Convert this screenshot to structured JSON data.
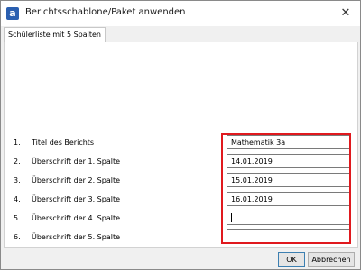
{
  "window": {
    "title": "Berichtsschablone/Paket anwenden",
    "app_icon": "a",
    "close_glyph": "✕"
  },
  "tabs": [
    {
      "label": "Schülerliste mit 5 Spalten",
      "active": true
    }
  ],
  "rows": [
    {
      "num": "1.",
      "label": "Titel des Berichts",
      "value": "Mathematik 3a"
    },
    {
      "num": "2.",
      "label": "Überschrift der 1. Spalte",
      "value": "14.01.2019"
    },
    {
      "num": "3.",
      "label": "Überschrift der 2. Spalte",
      "value": "15.01.2019"
    },
    {
      "num": "4.",
      "label": "Überschrift der 3. Spalte",
      "value": "16.01.2019"
    },
    {
      "num": "5.",
      "label": "Überschrift der 4. Spalte",
      "value": ""
    },
    {
      "num": "6.",
      "label": "Überschrift der 5. Spalte",
      "value": ""
    }
  ],
  "buttons": {
    "ok": "OK",
    "cancel": "Abbrechen"
  },
  "colors": {
    "highlight": "#e0191e",
    "icon": "#2a5fb0"
  }
}
